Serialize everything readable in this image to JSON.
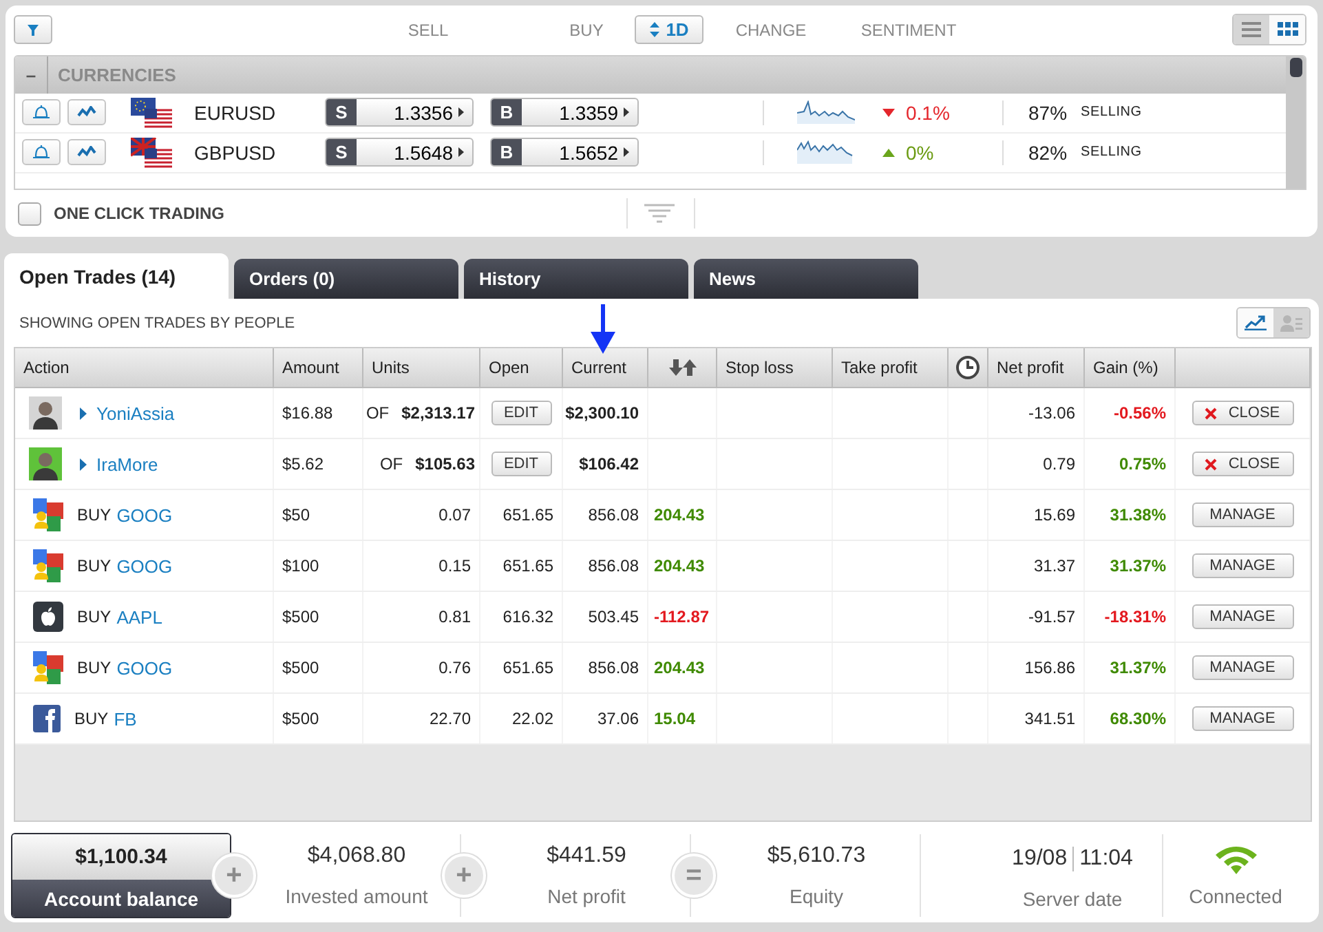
{
  "market": {
    "sell_label": "SELL",
    "buy_label": "BUY",
    "period": "1D",
    "change_label": "CHANGE",
    "sentiment_label": "SENTIMENT",
    "view_modes": [
      {
        "kind": "list",
        "selected": false
      },
      {
        "kind": "grid",
        "selected": true
      }
    ],
    "group": {
      "toggle": "–",
      "title": "CURRENCIES"
    },
    "instruments": [
      {
        "kind": "eu",
        "symbol": "EURUSD",
        "sell_key": "S",
        "sell": "1.3356",
        "buy_key": "B",
        "buy": "1.3359",
        "falling": true,
        "change": "0.1%",
        "sentiment": "87%",
        "sentiment_side": "SELLING"
      },
      {
        "kind": "gb",
        "symbol": "GBPUSD",
        "sell_key": "S",
        "sell": "1.5648",
        "buy_key": "B",
        "buy": "1.5652",
        "falling": false,
        "change": "0%",
        "sentiment": "82%",
        "sentiment_side": "SELLING"
      }
    ],
    "one_click": {
      "label": "ONE CLICK TRADING",
      "checked": false
    }
  },
  "tabs": [
    {
      "label": "Open Trades (14)",
      "selected": true
    },
    {
      "label": "Orders (0)",
      "selected": false
    },
    {
      "label": "History",
      "selected": false
    },
    {
      "label": "News",
      "selected": false
    }
  ],
  "trades": {
    "subtitle": "SHOWING OPEN TRADES BY PEOPLE",
    "display_modes": [
      {
        "kind": "chart",
        "selected": true
      },
      {
        "kind": "people",
        "selected": false
      }
    ],
    "columns": [
      {
        "kind": "text",
        "label": "Action"
      },
      {
        "kind": "text",
        "label": "Amount"
      },
      {
        "kind": "text",
        "label": "Units"
      },
      {
        "kind": "text",
        "label": "Open"
      },
      {
        "kind": "text",
        "label": "Current"
      },
      {
        "kind": "sort"
      },
      {
        "kind": "text",
        "label": "Stop loss"
      },
      {
        "kind": "text",
        "label": "Take profit"
      },
      {
        "kind": "clock"
      },
      {
        "kind": "text",
        "label": "Net profit"
      },
      {
        "kind": "text",
        "label": "Gain (%)"
      }
    ],
    "rows": [
      {
        "kind": "person",
        "name": "YoniAssia",
        "amount": "$16.88",
        "units_prefix": "OF",
        "units": "$2,313.17",
        "open_button": "EDIT",
        "current": "$2,300.10",
        "net_profit": "-13.06",
        "gain": "-0.56%",
        "negative": true,
        "action_button": "CLOSE"
      },
      {
        "kind": "person",
        "name": "IraMore",
        "amount": "$5.62",
        "units_prefix": "OF",
        "units": "$105.63",
        "open_button": "EDIT",
        "current": "$106.42",
        "net_profit": "0.79",
        "gain": "0.75%",
        "negative": false,
        "action_button": "CLOSE"
      },
      {
        "kind": "blocks",
        "side": "BUY",
        "symbol": "GOOG",
        "amount": "$50",
        "units": "0.07",
        "open": "651.65",
        "current": "856.08",
        "change": "204.43",
        "net_profit": "15.69",
        "gain": "31.38%",
        "negative": false,
        "action_button": "MANAGE"
      },
      {
        "kind": "blocks",
        "side": "BUY",
        "symbol": "GOOG",
        "amount": "$100",
        "units": "0.15",
        "open": "651.65",
        "current": "856.08",
        "change": "204.43",
        "net_profit": "31.37",
        "gain": "31.37%",
        "negative": false,
        "action_button": "MANAGE"
      },
      {
        "kind": "apple",
        "side": "BUY",
        "symbol": "AAPL",
        "amount": "$500",
        "units": "0.81",
        "open": "616.32",
        "current": "503.45",
        "change": "-112.87",
        "net_profit": "-91.57",
        "gain": "-18.31%",
        "negative": true,
        "action_button": "MANAGE"
      },
      {
        "kind": "blocks",
        "side": "BUY",
        "symbol": "GOOG",
        "amount": "$500",
        "units": "0.76",
        "open": "651.65",
        "current": "856.08",
        "change": "204.43",
        "net_profit": "156.86",
        "gain": "31.37%",
        "negative": false,
        "action_button": "MANAGE"
      },
      {
        "kind": "square",
        "side": "BUY",
        "symbol": "FB",
        "amount": "$500",
        "units": "22.70",
        "open": "22.02",
        "current": "37.06",
        "change": "15.04",
        "net_profit": "341.51",
        "gain": "68.30%",
        "negative": false,
        "action_button": "MANAGE"
      }
    ]
  },
  "footer": {
    "balance": {
      "value": "$1,100.34",
      "label": "Account balance"
    },
    "items": [
      {
        "kind": "operator",
        "symbol": "+"
      },
      {
        "kind": "stat",
        "value": "$4,068.80",
        "label": "Invested amount"
      },
      {
        "kind": "operator",
        "symbol": "+"
      },
      {
        "kind": "stat",
        "value": "$441.59",
        "label": "Net profit"
      },
      {
        "kind": "operator",
        "symbol": "="
      },
      {
        "kind": "stat",
        "value": "$5,610.73",
        "label": "Equity"
      }
    ],
    "server": {
      "date": "19/08",
      "time": "11:04",
      "label": "Server date"
    },
    "connection": {
      "label": "Connected",
      "on": true
    }
  }
}
